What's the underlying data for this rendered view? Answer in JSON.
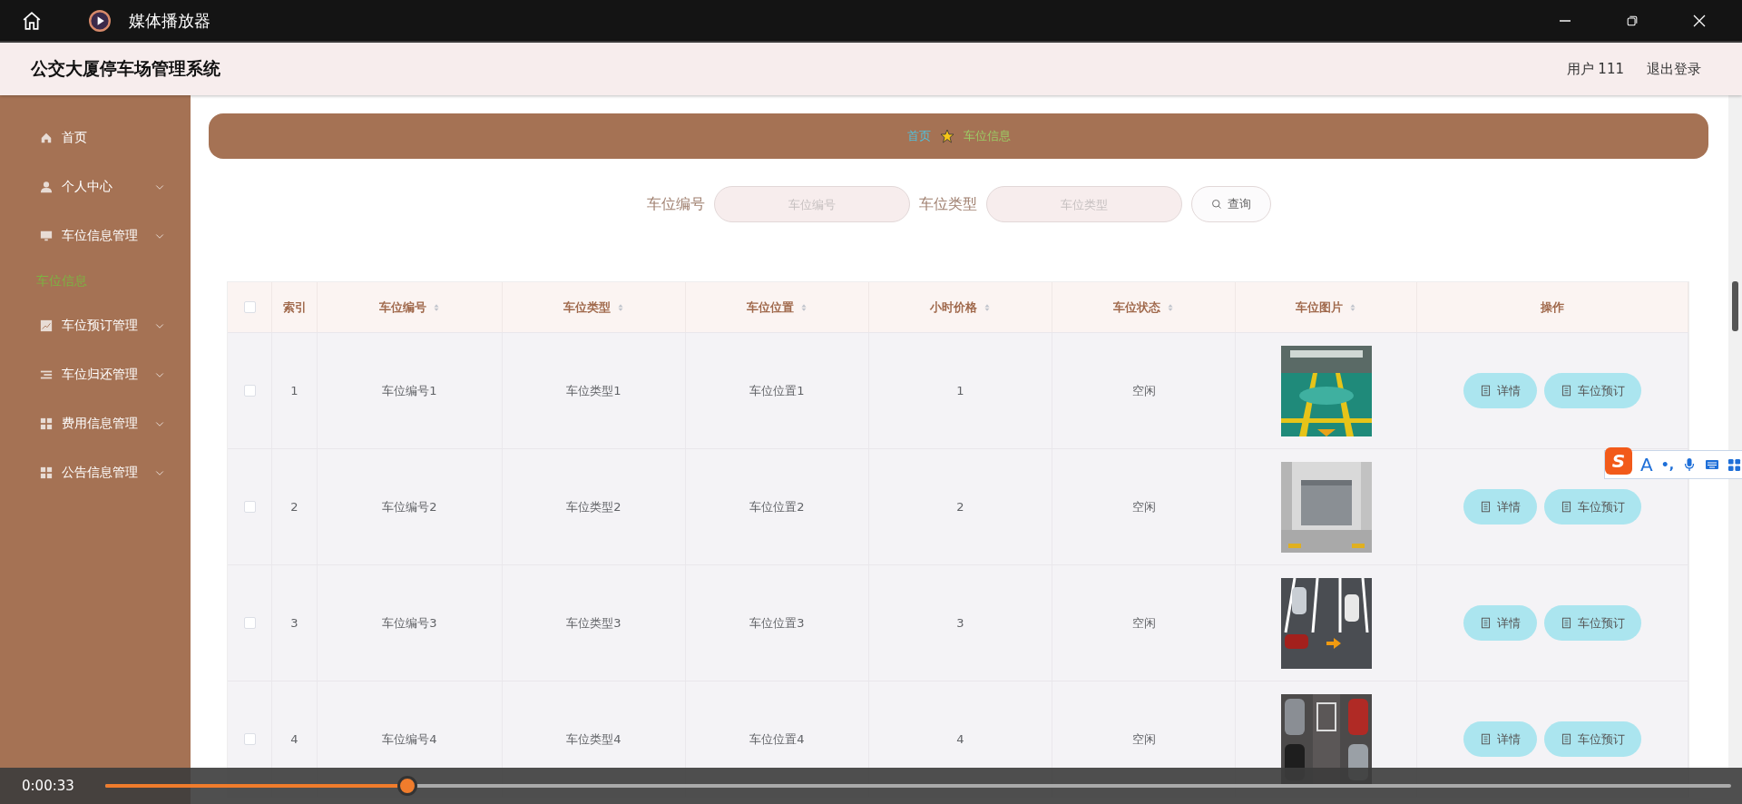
{
  "window": {
    "title": "媒体播放器"
  },
  "header": {
    "title": "公交大厦停车场管理系统",
    "user": "用户 111",
    "logout": "退出登录"
  },
  "sidebar": {
    "items": [
      {
        "label": "首页",
        "selected": false
      },
      {
        "label": "个人中心",
        "selected": false
      },
      {
        "label": "车位信息管理",
        "selected": false,
        "children": [
          {
            "label": "车位信息",
            "selected": true
          }
        ]
      },
      {
        "label": "车位预订管理",
        "selected": false
      },
      {
        "label": "车位归还管理",
        "selected": false
      },
      {
        "label": "费用信息管理",
        "selected": false
      },
      {
        "label": "公告信息管理",
        "selected": false
      }
    ]
  },
  "breadcrumb": [
    {
      "label": "首页",
      "color": "#4fc3e0"
    },
    {
      "label": "车位信息",
      "color": "#9ccc65"
    }
  ],
  "search": {
    "fields": [
      {
        "label": "车位编号",
        "placeholder": "车位编号"
      },
      {
        "label": "车位类型",
        "placeholder": "车位类型"
      }
    ],
    "button": "查询"
  },
  "table": {
    "select_all": {
      "checked": false
    },
    "columns": [
      {
        "label": "索引",
        "sortable": false
      },
      {
        "label": "车位编号",
        "sortable": true
      },
      {
        "label": "车位类型",
        "sortable": true
      },
      {
        "label": "车位位置",
        "sortable": true
      },
      {
        "label": "小时价格",
        "sortable": true
      },
      {
        "label": "车位状态",
        "sortable": true
      },
      {
        "label": "车位图片",
        "sortable": true
      },
      {
        "label": "操作",
        "sortable": false
      }
    ],
    "rows": [
      {
        "checked": false,
        "cells": [
          "1",
          "车位编号1",
          "车位类型1",
          "车位位置1",
          "1",
          "空闲"
        ],
        "actions": [
          "详情",
          "车位预订"
        ]
      },
      {
        "checked": false,
        "cells": [
          "2",
          "车位编号2",
          "车位类型2",
          "车位位置2",
          "2",
          "空闲"
        ],
        "actions": [
          "详情",
          "车位预订"
        ]
      },
      {
        "checked": false,
        "cells": [
          "3",
          "车位编号3",
          "车位类型3",
          "车位位置3",
          "3",
          "空闲"
        ],
        "actions": [
          "详情",
          "车位预订"
        ]
      },
      {
        "checked": false,
        "cells": [
          "4",
          "车位编号4",
          "车位类型4",
          "车位位置4",
          "4",
          "空闲"
        ],
        "actions": [
          "详情",
          "车位预订"
        ]
      }
    ]
  },
  "ime": {
    "logo": "S",
    "letter": "A",
    "punct": "•,"
  },
  "player": {
    "time": "0:00:33",
    "level": 0.186
  }
}
